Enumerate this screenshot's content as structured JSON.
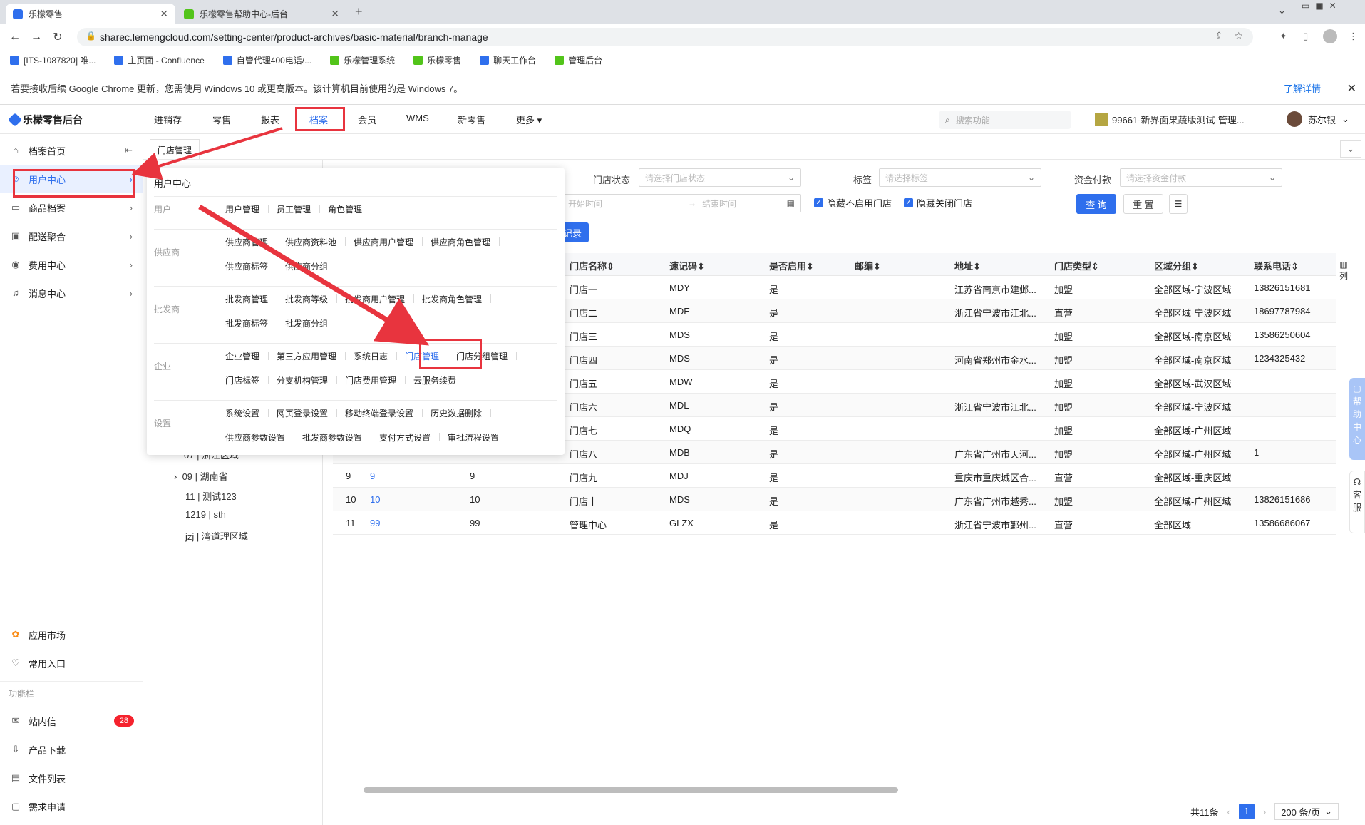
{
  "browser": {
    "tabs": [
      {
        "label": "乐檬零售",
        "icon_color": "#2f6fed"
      },
      {
        "label": "乐檬零售帮助中心-后台",
        "icon_color": "#52c41a"
      }
    ],
    "url": "sharec.lemengcloud.com/setting-center/product-archives/basic-material/branch-manage",
    "bookmarks": [
      {
        "label": "[ITS-1087820] 唯...",
        "color": "#2f6fed"
      },
      {
        "label": "主页面 - Confluence",
        "color": "#2f6fed"
      },
      {
        "label": "自管代理400电话/...",
        "color": "#2f6fed"
      },
      {
        "label": "乐檬管理系统",
        "color": "#52c41a"
      },
      {
        "label": "乐檬零售",
        "color": "#52c41a"
      },
      {
        "label": "聊天工作台",
        "color": "#2f6fed"
      },
      {
        "label": "管理后台",
        "color": "#52c41a"
      }
    ],
    "notice": "若要接收后续 Google Chrome 更新，您需使用 Windows 10 或更高版本。该计算机目前使用的是 Windows 7。",
    "notice_link": "了解详情"
  },
  "app": {
    "logo": "乐檬零售后台",
    "menu": [
      "进销存",
      "零售",
      "报表",
      "档案",
      "会员",
      "WMS",
      "新零售",
      "更多"
    ],
    "search_placeholder": "搜索功能",
    "store": "99661-新界面果蔬版测试-管理...",
    "user": "苏尔银"
  },
  "sidebar": {
    "items": [
      {
        "label": "档案首页",
        "icon": "home-icon",
        "glyph": "⌂"
      },
      {
        "label": "用户中心",
        "icon": "user-icon",
        "glyph": "☺"
      },
      {
        "label": "商品档案",
        "icon": "goods-icon",
        "glyph": "▭"
      },
      {
        "label": "配送聚合",
        "icon": "delivery-icon",
        "glyph": "▣"
      },
      {
        "label": "费用中心",
        "icon": "fee-icon",
        "glyph": "◉"
      },
      {
        "label": "消息中心",
        "icon": "bell-icon",
        "glyph": "♫"
      }
    ],
    "bottom": [
      {
        "label": "应用市场",
        "icon": "market-icon",
        "glyph": "✿"
      },
      {
        "label": "常用入口",
        "icon": "heart-icon",
        "glyph": "♡"
      }
    ],
    "section_label": "功能栏",
    "tools": [
      {
        "label": "站内信",
        "icon": "mail-icon",
        "glyph": "✉",
        "badge": "28"
      },
      {
        "label": "产品下载",
        "icon": "download-icon",
        "glyph": "⇩"
      },
      {
        "label": "文件列表",
        "icon": "file-list-icon",
        "glyph": "▤"
      },
      {
        "label": "需求申请",
        "icon": "request-icon",
        "glyph": "▢"
      }
    ]
  },
  "page": {
    "tab": "门店管理",
    "tree": [
      "07 | 浙江区域",
      "09 | 湖南省",
      "11 | 测试123",
      "1219 | sth",
      "jzj | 湾道理区域"
    ],
    "filters": {
      "status_label": "门店状态",
      "status_placeholder": "请选择门店状态",
      "tag_label": "标签",
      "tag_placeholder": "请选择标签",
      "fund_label": "资金付款",
      "fund_placeholder": "请选择资金付款",
      "start_placeholder": "开始时间",
      "end_placeholder": "结束时间",
      "hide_disabled": "隐藏不启用门店",
      "hide_closed": "隐藏关闭门店",
      "query": "查 询",
      "reset": "重 置"
    },
    "record_btn": "记录",
    "columns": [
      "门店名称",
      "速记码",
      "是否启用",
      "邮编",
      "地址",
      "门店类型",
      "区域分组",
      "联系电话"
    ],
    "col_setting": "列",
    "rows": [
      {
        "name": "门店一",
        "code": "MDY",
        "enabled": "是",
        "zip": "",
        "addr": "江苏省南京市建邺...",
        "type": "加盟",
        "region": "全部区域-宁波区域",
        "phone": "13826151681"
      },
      {
        "name": "门店二",
        "code": "MDE",
        "enabled": "是",
        "zip": "",
        "addr": "浙江省宁波市江北...",
        "type": "直营",
        "region": "全部区域-宁波区域",
        "phone": "18697787984"
      },
      {
        "name": "门店三",
        "code": "MDS",
        "enabled": "是",
        "zip": "",
        "addr": "",
        "type": "加盟",
        "region": "全部区域-南京区域",
        "phone": "13586250604"
      },
      {
        "name": "门店四",
        "code": "MDS",
        "enabled": "是",
        "zip": "",
        "addr": "河南省郑州市金水...",
        "type": "加盟",
        "region": "全部区域-南京区域",
        "phone": "1234325432"
      },
      {
        "name": "门店五",
        "code": "MDW",
        "enabled": "是",
        "zip": "",
        "addr": "",
        "type": "加盟",
        "region": "全部区域-武汉区域",
        "phone": ""
      },
      {
        "name": "门店六",
        "code": "MDL",
        "enabled": "是",
        "zip": "",
        "addr": "浙江省宁波市江北...",
        "type": "加盟",
        "region": "全部区域-宁波区域",
        "phone": ""
      },
      {
        "name": "门店七",
        "code": "MDQ",
        "enabled": "是",
        "zip": "",
        "addr": "",
        "type": "加盟",
        "region": "全部区域-广州区域",
        "phone": ""
      },
      {
        "name": "门店八",
        "code": "MDB",
        "enabled": "是",
        "zip": "",
        "addr": "广东省广州市天河...",
        "type": "加盟",
        "region": "全部区域-广州区域",
        "phone": "1"
      },
      {
        "idx": "9",
        "no": "9",
        "num": "9",
        "name": "门店九",
        "code": "MDJ",
        "enabled": "是",
        "zip": "",
        "addr": "重庆市重庆城区合...",
        "type": "直营",
        "region": "全部区域-重庆区域",
        "phone": ""
      },
      {
        "idx": "10",
        "no": "10",
        "num": "10",
        "name": "门店十",
        "code": "MDS",
        "enabled": "是",
        "zip": "",
        "addr": "广东省广州市越秀...",
        "type": "加盟",
        "region": "全部区域-广州区域",
        "phone": "13826151686"
      },
      {
        "idx": "11",
        "no": "99",
        "num": "99",
        "name": "管理中心",
        "code": "GLZX",
        "enabled": "是",
        "zip": "",
        "addr": "浙江省宁波市鄞州...",
        "type": "直营",
        "region": "全部区域",
        "phone": "13586686067"
      }
    ],
    "pager": {
      "total": "共11条",
      "current": "1",
      "size": "200 条/页"
    },
    "help": [
      "帮",
      "助",
      "中",
      "心"
    ],
    "kefu": [
      "客",
      "服"
    ]
  },
  "popup": {
    "title": "用户中心",
    "groups": [
      {
        "cat": "用户",
        "lines": [
          [
            "用户管理",
            "员工管理",
            "角色管理"
          ]
        ]
      },
      {
        "cat": "供应商",
        "lines": [
          [
            "供应商管理",
            "供应商资料池",
            "供应商用户管理",
            "供应商角色管理"
          ],
          [
            "供应商标签",
            "供应商分组"
          ]
        ]
      },
      {
        "cat": "批发商",
        "lines": [
          [
            "批发商管理",
            "批发商等级",
            "批发商用户管理",
            "批发商角色管理"
          ],
          [
            "批发商标签",
            "批发商分组"
          ]
        ]
      },
      {
        "cat": "企业",
        "lines": [
          [
            "企业管理",
            "第三方应用管理",
            "系统日志",
            "门店管理",
            "门店分组管理"
          ],
          [
            "门店标签",
            "分支机构管理",
            "门店费用管理",
            "云服务续费"
          ]
        ]
      },
      {
        "cat": "设置",
        "lines": [
          [
            "系统设置",
            "网页登录设置",
            "移动终端登录设置",
            "历史数据删除"
          ],
          [
            "供应商参数设置",
            "批发商参数设置",
            "支付方式设置",
            "审批流程设置"
          ]
        ]
      }
    ],
    "highlight": "门店管理"
  },
  "colors": {
    "accent": "#2f6fed",
    "annotation": "#e8343e",
    "badge": "#f5222d"
  }
}
